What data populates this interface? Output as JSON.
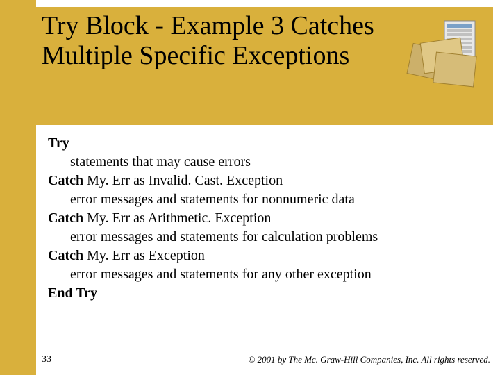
{
  "title": "Try Block - Example 3 Catches Multiple Specific Exceptions",
  "code": {
    "try": "Try",
    "try_body": "statements that may cause errors",
    "catch1_kw": "Catch",
    "catch1_rest": " My. Err as Invalid. Cast. Exception",
    "catch1_body": "error messages and statements for nonnumeric data",
    "catch2_kw": "Catch",
    "catch2_rest": " My. Err as Arithmetic. Exception",
    "catch2_body": "error messages and statements for calculation problems",
    "catch3_kw": "Catch",
    "catch3_rest": " My. Err as Exception",
    "catch3_body": "error messages and statements for any other exception",
    "end": "End Try"
  },
  "page_number": "33",
  "copyright": "© 2001 by The Mc. Graw-Hill Companies, Inc. All rights reserved."
}
